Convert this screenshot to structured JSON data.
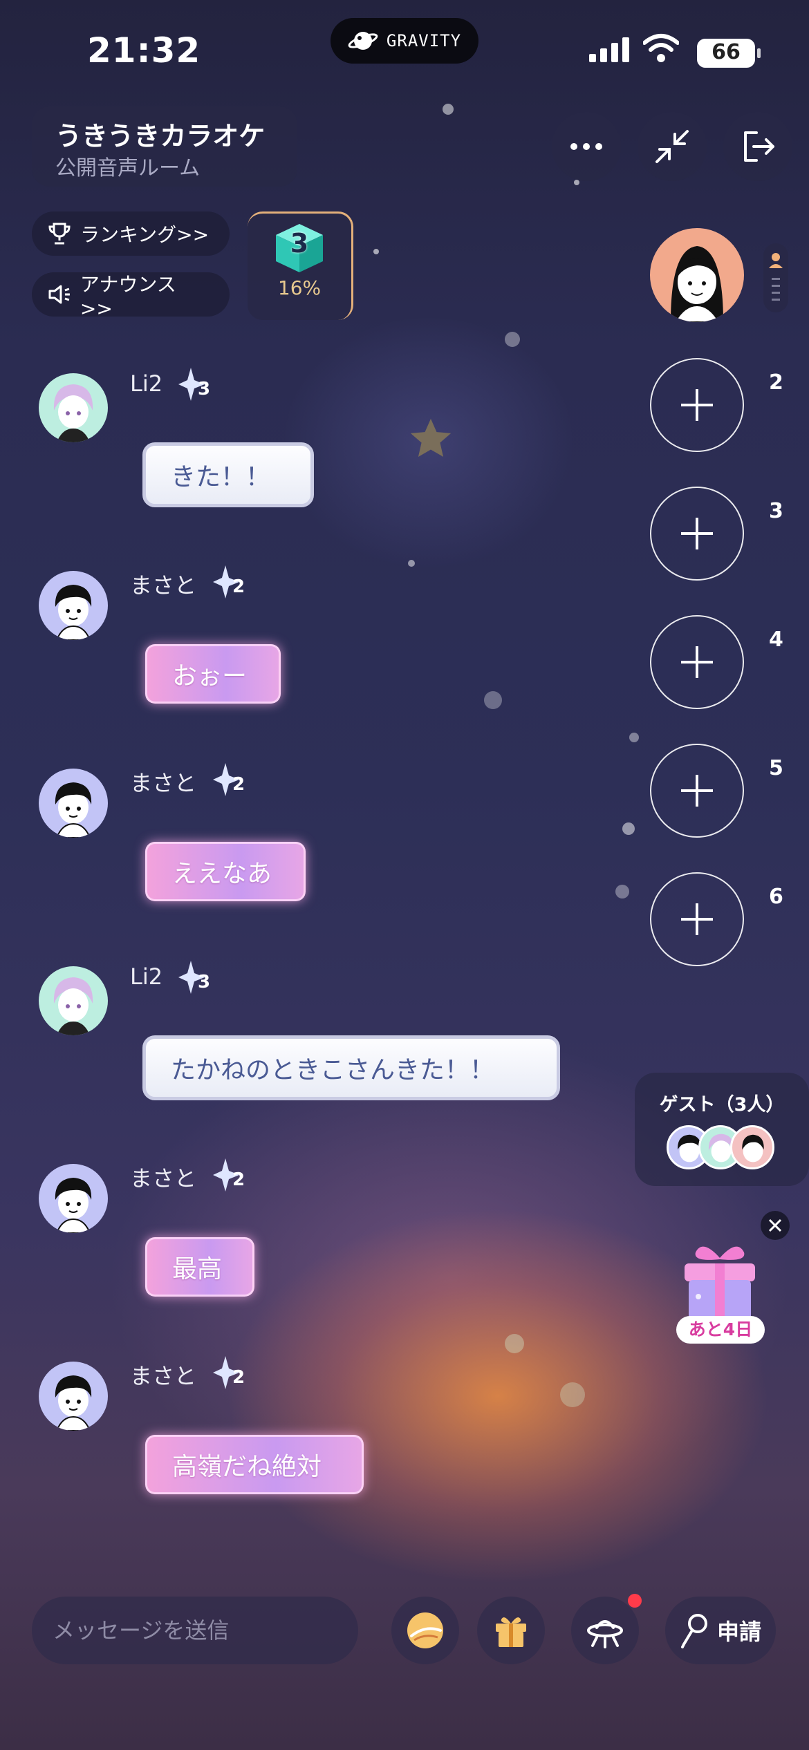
{
  "status": {
    "time": "21:32",
    "brand": "GRAVITY",
    "battery": "66"
  },
  "room": {
    "title": "うきうきカラオケ",
    "subtitle": "公開音声ルーム"
  },
  "chips": {
    "ranking": "ランキング>>",
    "announce": "アナウンス >>"
  },
  "level": {
    "value": "3",
    "percent": "16%"
  },
  "seats": [
    "2",
    "3",
    "4",
    "5",
    "6"
  ],
  "messages": [
    {
      "user": "Li2",
      "level": "3",
      "text": "きた！！",
      "style": "white"
    },
    {
      "user": "まさと",
      "level": "2",
      "text": "おぉー",
      "style": "pink"
    },
    {
      "user": "まさと",
      "level": "2",
      "text": "ええなあ",
      "style": "pink"
    },
    {
      "user": "Li2",
      "level": "3",
      "text": "たかねのときこさんきた！！",
      "style": "white"
    },
    {
      "user": "まさと",
      "level": "2",
      "text": "最高",
      "style": "pink"
    },
    {
      "user": "まさと",
      "level": "2",
      "text": "高嶺だね絶対",
      "style": "pink"
    }
  ],
  "guests": {
    "title": "ゲスト（3人）"
  },
  "gift_promo": {
    "label": "あと4日"
  },
  "bottom": {
    "placeholder": "メッセージを送信",
    "apply": "申請"
  },
  "colors": {
    "accent_pink": "#f3a2dc",
    "notification": "#ff3b4a",
    "level_gold": "#e8c98f"
  }
}
